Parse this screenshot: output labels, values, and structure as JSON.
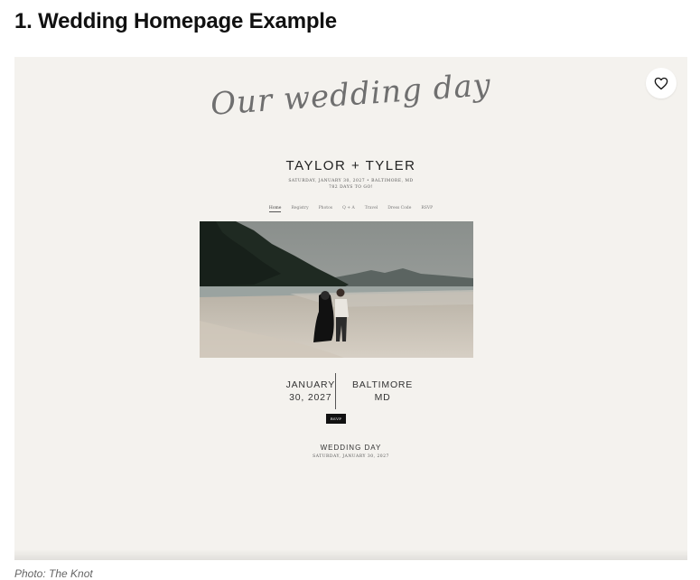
{
  "article": {
    "heading": "1. Wedding Homepage Example",
    "photo_credit": "Photo: The Knot"
  },
  "website": {
    "script_title": "Our wedding day",
    "couple_names": "TAYLOR + TYLER",
    "date_location_line": "SATURDAY, JANUARY 30, 2027 • BALTIMORE, MD",
    "countdown": "782 DAYS TO GO!",
    "nav": [
      {
        "label": "Home",
        "active": true
      },
      {
        "label": "Registry",
        "active": false
      },
      {
        "label": "Photos",
        "active": false
      },
      {
        "label": "Q + A",
        "active": false
      },
      {
        "label": "Travel",
        "active": false
      },
      {
        "label": "Dress Code",
        "active": false
      },
      {
        "label": "RSVP",
        "active": false
      }
    ],
    "date_line1": "JANUARY",
    "date_line2": "30, 2027",
    "place_line1": "BALTIMORE",
    "place_line2": "MD",
    "rsvp_label": "RSVP",
    "event_name": "WEDDING DAY",
    "event_date": "SATURDAY, JANUARY 30, 2027"
  },
  "icons": {
    "favorite": "heart-icon"
  },
  "colors": {
    "frame_background": "#f4f2ee",
    "rsvp_background": "#111111"
  }
}
